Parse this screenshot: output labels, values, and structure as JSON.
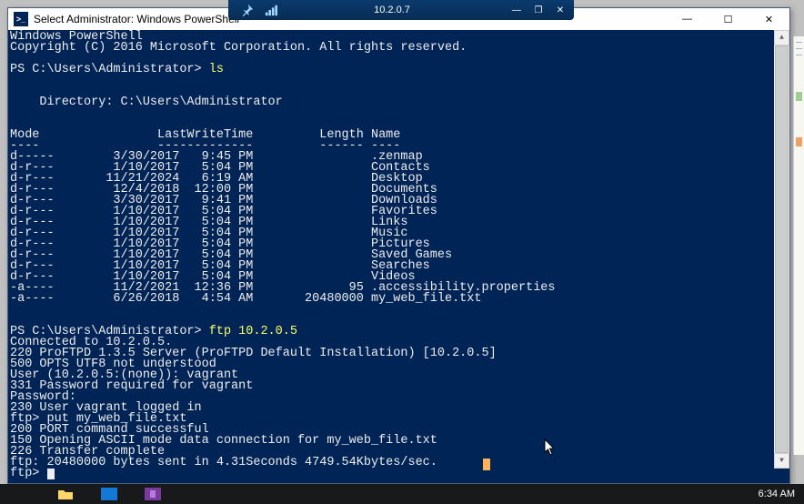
{
  "rdp": {
    "title": "10.2.0.7",
    "pin_icon": "pin-icon",
    "signal_icon": "signal-icon",
    "min": "—",
    "restore": "❐",
    "close": "✕"
  },
  "ps_window": {
    "icon_glyph": ">_",
    "title": "Select Administrator: Windows PowerShell",
    "min": "—",
    "max": "☐",
    "close": "✕"
  },
  "terminal": {
    "banner1": "Windows PowerShell",
    "banner2": "Copyright (C) 2016 Microsoft Corporation. All rights reserved.",
    "prompt1_pre": "PS C:\\Users\\Administrator> ",
    "prompt1_cmd": "ls",
    "dir_header": "    Directory: C:\\Users\\Administrator",
    "col_header": "Mode                LastWriteTime         Length Name",
    "col_rule": "----                -------------         ------ ----",
    "rows": [
      "d-----        3/30/2017   9:45 PM                .zenmap",
      "d-r---        1/10/2017   5:04 PM                Contacts",
      "d-r---       11/21/2024   6:19 AM                Desktop",
      "d-r---        12/4/2018  12:00 PM                Documents",
      "d-r---        3/30/2017   9:41 PM                Downloads",
      "d-r---        1/10/2017   5:04 PM                Favorites",
      "d-r---        1/10/2017   5:04 PM                Links",
      "d-r---        1/10/2017   5:04 PM                Music",
      "d-r---        1/10/2017   5:04 PM                Pictures",
      "d-r---        1/10/2017   5:04 PM                Saved Games",
      "d-r---        1/10/2017   5:04 PM                Searches",
      "d-r---        1/10/2017   5:04 PM                Videos",
      "-a----        11/2/2021  12:36 PM             95 .accessibility.properties",
      "-a----        6/26/2018   4:54 AM       20480000 my_web_file.txt"
    ],
    "prompt2_pre": "PS C:\\Users\\Administrator> ",
    "prompt2_cmd": "ftp 10.2.0.5",
    "ftp": [
      "Connected to 10.2.0.5.",
      "220 ProFTPD 1.3.5 Server (ProFTPD Default Installation) [10.2.0.5]",
      "500 OPTS UTF8 not understood",
      "User (10.2.0.5:(none)): vagrant",
      "331 Password required for vagrant",
      "Password:",
      "230 User vagrant logged in",
      "ftp> put my_web_file.txt",
      "200 PORT command successful",
      "150 Opening ASCII mode data connection for my_web_file.txt",
      "226 Transfer complete",
      "ftp: 20480000 bytes sent in 4.31Seconds 4749.54Kbytes/sec."
    ],
    "ftp_prompt": "ftp> "
  },
  "scrollbar": {
    "up": "▲",
    "down": "▼"
  },
  "taskbar": {
    "clock": "6:34 AM"
  }
}
